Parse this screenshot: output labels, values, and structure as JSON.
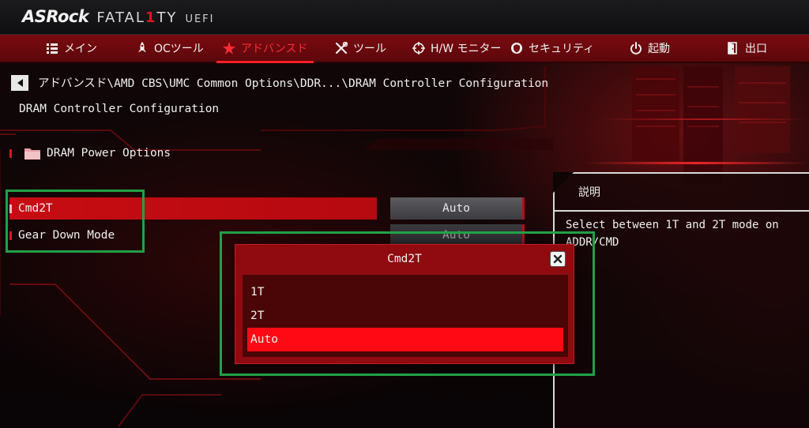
{
  "brand": {
    "asrock": "ASRock",
    "fatal_a": "FATAL",
    "fatal_one": "1",
    "fatal_b": "TY",
    "uefi": "UEFI"
  },
  "menu": [
    {
      "label": "メイン",
      "icon": "list-icon"
    },
    {
      "label": "OCツール",
      "icon": "rocket-icon"
    },
    {
      "label": "アドバンスド",
      "icon": "star-icon",
      "active": true
    },
    {
      "label": "ツール",
      "icon": "tools-icon"
    },
    {
      "label": "H/W モニター",
      "icon": "crosshair-icon"
    },
    {
      "label": "セキュリティ",
      "icon": "shield-icon"
    },
    {
      "label": "起動",
      "icon": "power-icon"
    },
    {
      "label": "出口",
      "icon": "exit-door-icon"
    }
  ],
  "breadcrumb": "アドバンスド\\AMD CBS\\UMC Common Options\\DDR...\\DRAM Controller Configuration",
  "page_title": "DRAM Controller Configuration",
  "folder": {
    "label": "DRAM Power Options"
  },
  "options": [
    {
      "label": "Cmd2T",
      "value": "Auto"
    },
    {
      "label": "Gear Down Mode",
      "value": "Auto"
    }
  ],
  "description": {
    "title": "説明",
    "text": "Select between 1T and 2T mode on ADDR/CMD"
  },
  "popup": {
    "title": "Cmd2T",
    "options": [
      "1T",
      "2T",
      "Auto"
    ],
    "selected": "Auto"
  },
  "colors": {
    "accent": "#e0141c",
    "menubar": "#7a0b10",
    "highlight": "#ff0a14",
    "annotation": "#22a046"
  }
}
